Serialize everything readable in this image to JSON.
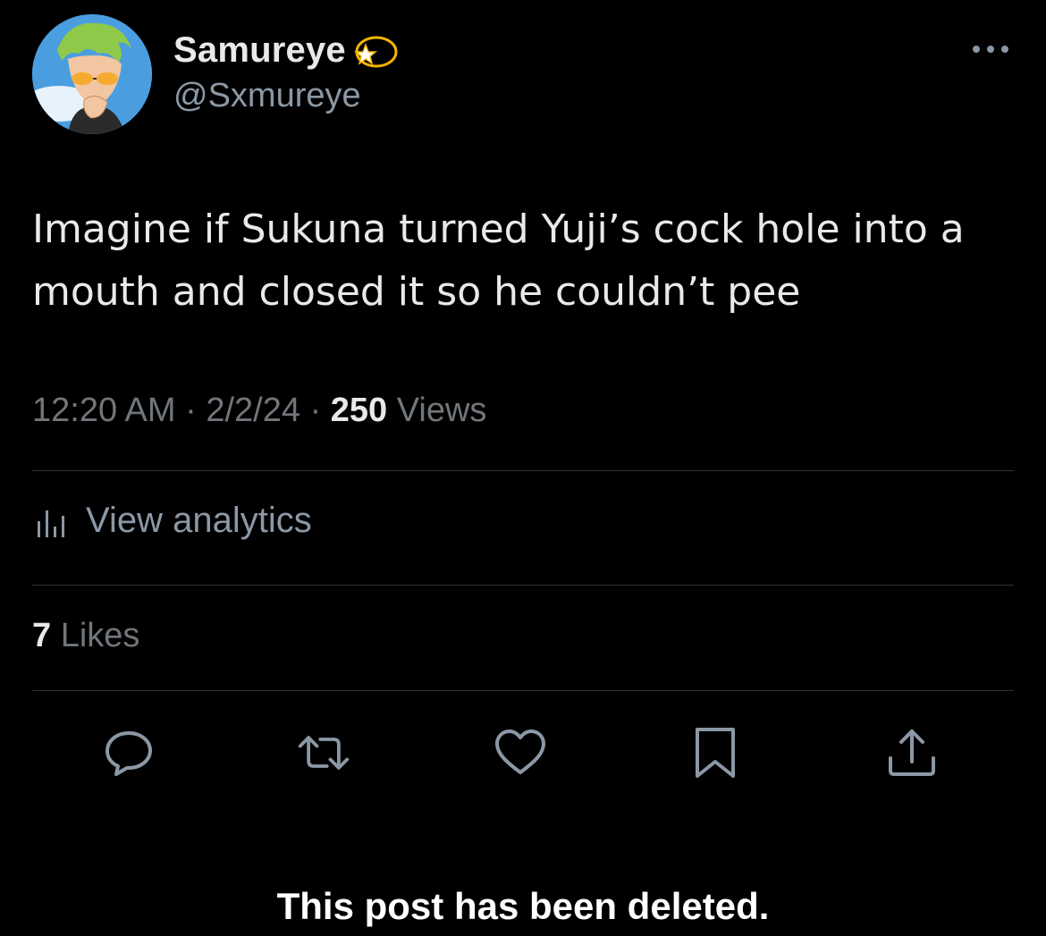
{
  "author": {
    "display_name": "Samureye",
    "display_name_emoji": "dizzy-star-emoji",
    "handle": "@Sxmureye",
    "avatar": "anime-character-green-hair-avatar"
  },
  "tweet": {
    "text": "Imagine if Sukuna turned Yuji’s cock hole into a mouth and closed it so he couldn’t pee",
    "time": "12:20 AM",
    "date": "2/2/24",
    "separator": "·",
    "views_count": "250",
    "views_label": "Views"
  },
  "analytics": {
    "icon": "bar-chart-icon",
    "label": "View analytics"
  },
  "likes": {
    "count": "7",
    "label": "Likes"
  },
  "actions": [
    {
      "name": "reply-icon"
    },
    {
      "name": "retweet-icon"
    },
    {
      "name": "like-icon"
    },
    {
      "name": "bookmark-icon"
    },
    {
      "name": "share-icon"
    }
  ],
  "status": {
    "deleted_message": "This post has been deleted."
  },
  "colors": {
    "background": "#000000",
    "primary_text": "#e7e9ea",
    "secondary_text": "#71767b",
    "icon": "#8b98a5",
    "divider": "#2f3336"
  }
}
